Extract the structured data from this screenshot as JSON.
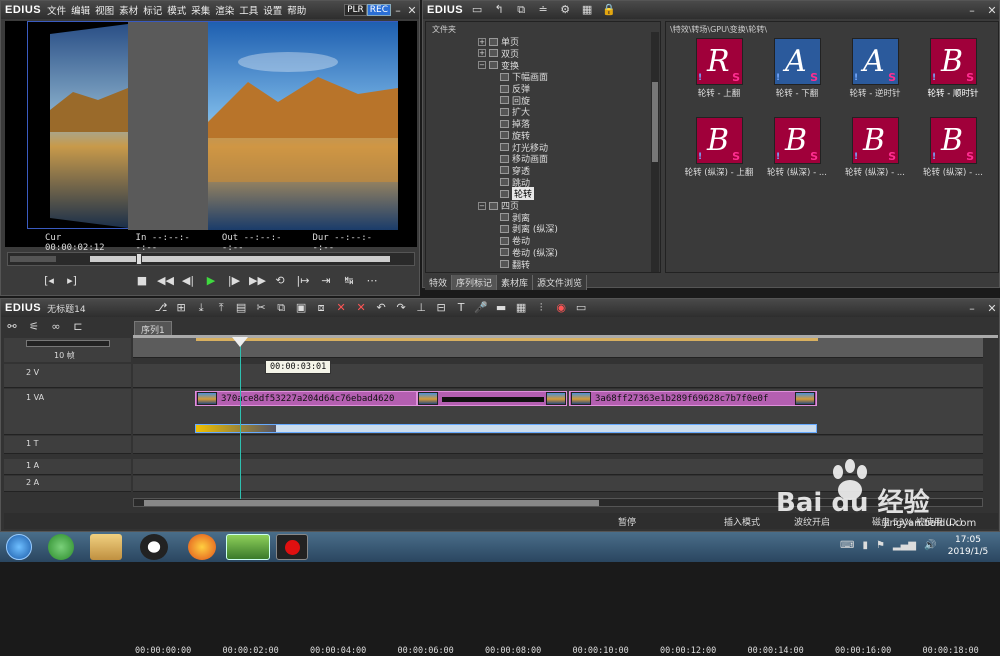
{
  "player": {
    "logo": "EDIUS",
    "menu": [
      "文件",
      "编辑",
      "视图",
      "素材",
      "标记",
      "模式",
      "采集",
      "渲染",
      "工具",
      "设置",
      "帮助"
    ],
    "plr": "PLR",
    "rec": "REC",
    "cur_label": "Cur",
    "cur_value": "00:00:02:12",
    "in_label": "In",
    "in_value": "--:--:--:--",
    "out_label": "Out",
    "out_value": "--:--:--:--",
    "dur_label": "Dur",
    "dur_value": "--:--:--:--"
  },
  "library": {
    "logo": "EDIUS",
    "folder_header": "文件夹",
    "path": "\\特效\\转场\\GPU\\变换\\轮转\\",
    "tree": [
      {
        "label": "单页",
        "kind": "plus"
      },
      {
        "label": "双页",
        "kind": "plus"
      },
      {
        "label": "变换",
        "kind": "minus"
      },
      {
        "label": "下幅画面",
        "kind": "leaf"
      },
      {
        "label": "反弹",
        "kind": "leaf"
      },
      {
        "label": "回旋",
        "kind": "leaf"
      },
      {
        "label": "扩大",
        "kind": "leaf"
      },
      {
        "label": "掉落",
        "kind": "leaf"
      },
      {
        "label": "旋转",
        "kind": "leaf"
      },
      {
        "label": "灯光移动",
        "kind": "leaf"
      },
      {
        "label": "移动画面",
        "kind": "leaf"
      },
      {
        "label": "穿透",
        "kind": "leaf"
      },
      {
        "label": "跳动",
        "kind": "leaf"
      },
      {
        "label": "轮转",
        "kind": "leaf-selected"
      },
      {
        "label": "四页",
        "kind": "minus"
      },
      {
        "label": "剥离",
        "kind": "leaf"
      },
      {
        "label": "剥离 (纵深)",
        "kind": "leaf"
      },
      {
        "label": "卷动",
        "kind": "leaf"
      },
      {
        "label": "卷动 (纵深)",
        "kind": "leaf"
      },
      {
        "label": "翻转",
        "kind": "leaf"
      }
    ],
    "effects": [
      {
        "label": "轮转 - 上翻",
        "letter": "R"
      },
      {
        "label": "轮转 - 下翻",
        "letter": "A"
      },
      {
        "label": "轮转 - 逆时针",
        "letter": "A"
      },
      {
        "label": "轮转 - 顺时针",
        "letter": "B"
      },
      {
        "label": "轮转 (纵深) - 上翻",
        "letter": "B"
      },
      {
        "label": "轮转 (纵深) - ...",
        "letter": "B"
      },
      {
        "label": "轮转 (纵深) - ...",
        "letter": "B"
      },
      {
        "label": "轮转 (纵深) - ...",
        "letter": "B"
      }
    ],
    "tabs": [
      "特效",
      "序列标记",
      "素材库",
      "源文件浏览"
    ]
  },
  "timeline": {
    "logo": "EDIUS",
    "project_name": "无标题14",
    "sequence_tab": "序列1",
    "track_count_label": "10 帧",
    "ruler_ticks": [
      "00:00:00:00",
      "00:00:02:00",
      "00:00:04:00",
      "00:00:06:00",
      "00:00:08:00",
      "00:00:10:00",
      "00:00:12:00",
      "00:00:14:00",
      "00:00:16:00",
      "00:00:18:00"
    ],
    "hover_timecode": "00:00:03:01",
    "tracks": {
      "v2": "2 V",
      "va1": "1 VA",
      "t1": "1 T",
      "a1": "1 A",
      "a2": "2 A"
    },
    "clip1_name": "370ace8df53227a204d64c76ebad4620",
    "clip2_name": "3a68ff27363e1b289f69628c7b7f0e0f",
    "status": {
      "pause": "暂停",
      "insert_mode": "插入模式",
      "ripple_on": "波纹开启",
      "disk": "磁盘 53% 被使用 (D:)"
    }
  },
  "taskbar": {
    "time": "17:05",
    "date": "2019/1/5"
  },
  "watermark": {
    "brand": "Bai du 经验",
    "url": "jingyan.baidu.com"
  },
  "colors": {
    "accent": "#2b6fd6",
    "clip": "#b45fb1",
    "playhead": "#2ec0b0"
  }
}
